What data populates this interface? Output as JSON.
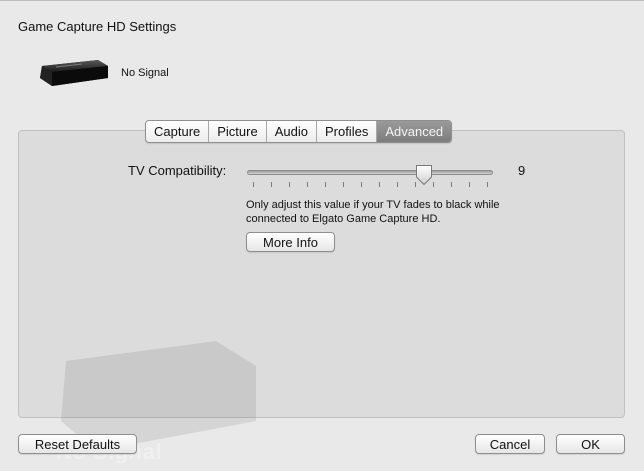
{
  "window": {
    "title": "Game Capture HD Settings"
  },
  "device": {
    "status": "No Signal"
  },
  "tabs": [
    {
      "label": "Capture",
      "selected": false
    },
    {
      "label": "Picture",
      "selected": false
    },
    {
      "label": "Audio",
      "selected": false
    },
    {
      "label": "Profiles",
      "selected": false
    },
    {
      "label": "Advanced",
      "selected": true
    }
  ],
  "advanced": {
    "tv_compat_label": "TV Compatibility:",
    "tv_compat_value": "9",
    "tv_compat_fraction": 0.73,
    "tick_count": 14,
    "hint_text": "Only adjust this value if your TV fades to black while connected to Elgato Game Capture HD.",
    "more_info_label": "More Info",
    "preview_overlay_text": "No Signal"
  },
  "footer": {
    "reset_label": "Reset Defaults",
    "cancel_label": "Cancel",
    "ok_label": "OK"
  },
  "colors": {
    "window_bg": "#e9e9e9",
    "panel_bg": "#dcdcdc",
    "selected_tab": "#888888"
  }
}
